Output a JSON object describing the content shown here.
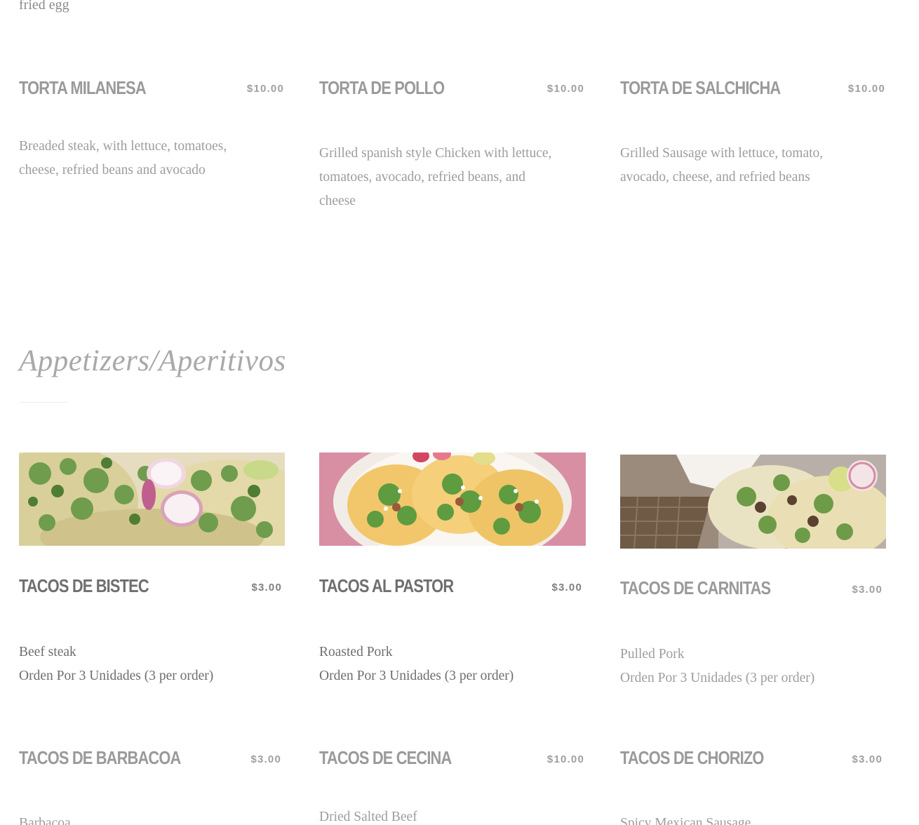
{
  "fragment_text": "fried egg",
  "tortas": [
    {
      "name": "TORTA MILANESA",
      "price": "$10.00",
      "desc_lines": [
        "Breaded steak, with lettuce, tomatoes,",
        "cheese, refried beans and avocado"
      ]
    },
    {
      "name": "TORTA DE POLLO",
      "price": "$10.00",
      "desc_lines": [
        "Grilled spanish style Chicken with lettuce,",
        "tomatoes, avocado, refried beans, and",
        "cheese"
      ]
    },
    {
      "name": "TORTA DE SALCHICHA",
      "price": "$10.00",
      "desc_lines": [
        "Grilled Sausage with lettuce, tomato,",
        "avocado, cheese, and refried beans"
      ]
    }
  ],
  "appetizers": {
    "title": "Appetizers/Aperitivos",
    "items": [
      {
        "name": "TACOS DE BISTEC",
        "price": "$3.00",
        "desc_lines": [
          "Beef steak",
          "Orden Por 3 Unidades (3 per order)"
        ],
        "image": "tacos-photo"
      },
      {
        "name": "TACOS AL PASTOR",
        "price": "$3.00",
        "desc_lines": [
          "Roasted Pork",
          "Orden Por 3 Unidades (3 per order)"
        ],
        "image": "tacos-photo"
      },
      {
        "name": "TACOS DE CARNITAS",
        "price": "$3.00",
        "desc_lines": [
          "Pulled Pork",
          "Orden Por 3 Unidades (3 per order)"
        ],
        "image": "tacos-photo"
      },
      {
        "name": "TACOS DE BARBACOA",
        "price": "$3.00",
        "desc_lines": [
          "Barbacoa"
        ]
      },
      {
        "name": "TACOS DE CECINA",
        "price": "$10.00",
        "desc_lines": [
          "Dried Salted Beef"
        ]
      },
      {
        "name": "TACOS DE CHORIZO",
        "price": "$3.00",
        "desc_lines": [
          "Spicy Mexican Sausage"
        ]
      }
    ]
  }
}
